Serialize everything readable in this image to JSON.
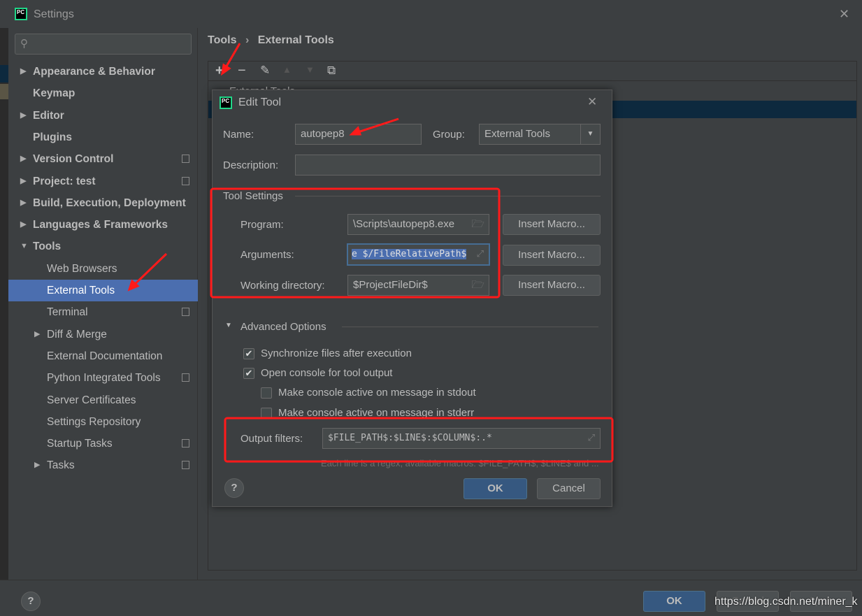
{
  "window": {
    "title": "Settings",
    "close": "✕"
  },
  "sidebar": {
    "search_placeholder": "",
    "items": [
      {
        "label": "Appearance & Behavior",
        "expandable": true,
        "bold": true
      },
      {
        "label": "Keymap",
        "bold": true
      },
      {
        "label": "Editor",
        "expandable": true,
        "bold": true
      },
      {
        "label": "Plugins",
        "bold": true
      },
      {
        "label": "Version Control",
        "expandable": true,
        "bold": true,
        "project_icon": true
      },
      {
        "label": "Project: test",
        "expandable": true,
        "bold": true,
        "project_icon": true
      },
      {
        "label": "Build, Execution, Deployment",
        "expandable": true,
        "bold": true
      },
      {
        "label": "Languages & Frameworks",
        "expandable": true,
        "bold": true
      },
      {
        "label": "Tools",
        "expanded": true,
        "bold": true
      },
      {
        "label": "Web Browsers"
      },
      {
        "label": "External Tools",
        "selected": true
      },
      {
        "label": "Terminal",
        "project_icon": true
      },
      {
        "label": "Diff & Merge",
        "expandable": true
      },
      {
        "label": "External Documentation"
      },
      {
        "label": "Python Integrated Tools",
        "project_icon": true
      },
      {
        "label": "Server Certificates"
      },
      {
        "label": "Settings Repository"
      },
      {
        "label": "Startup Tasks",
        "project_icon": true
      },
      {
        "label": "Tasks",
        "expandable": true,
        "project_icon": true
      }
    ]
  },
  "breadcrumb": {
    "parent": "Tools",
    "separator": "›",
    "current": "External Tools"
  },
  "toolbar": {
    "add": "+",
    "remove": "−",
    "edit": "✎",
    "up": "▲",
    "down": "▼",
    "copy": "⧉"
  },
  "tree": {
    "group": "External Tools"
  },
  "dialog": {
    "title": "Edit Tool",
    "close": "✕",
    "name_label": "Name:",
    "name_value": "autopep8",
    "group_label": "Group:",
    "group_value": "External Tools",
    "description_label": "Description:",
    "description_value": "",
    "tool_settings": "Tool Settings",
    "program_label": "Program:",
    "program_value": "\\Scripts\\autopep8.exe",
    "arguments_label": "Arguments:",
    "arguments_value": "e $/FileRelativePath$",
    "workdir_label": "Working directory:",
    "workdir_value": "$ProjectFileDir$",
    "insert_macro": "Insert Macro...",
    "advanced": "Advanced Options",
    "sync": {
      "label": "Synchronize files after execution",
      "checked": true
    },
    "console": {
      "label": "Open console for tool output",
      "checked": true
    },
    "stdout": {
      "label": "Make console active on message in stdout",
      "checked": false
    },
    "stderr": {
      "label": "Make console active on message in stderr",
      "checked": false
    },
    "output_label": "Output filters:",
    "output_value": "$FILE_PATH$:$LINE$:$COLUMN$:.*",
    "output_hint": "Each line is a regex, available macros: $FILE_PATH$, $LINE$ and ...",
    "help": "?",
    "ok": "OK",
    "cancel": "Cancel"
  },
  "footer": {
    "help": "?",
    "ok": "OK",
    "cancel": "Cancel",
    "apply": "Apply"
  },
  "watermark": "https://blog.csdn.net/miner_k",
  "colors": {
    "selection": "#4b6eaf",
    "annotation": "#ff1a1a",
    "ok_button": "#365880"
  }
}
